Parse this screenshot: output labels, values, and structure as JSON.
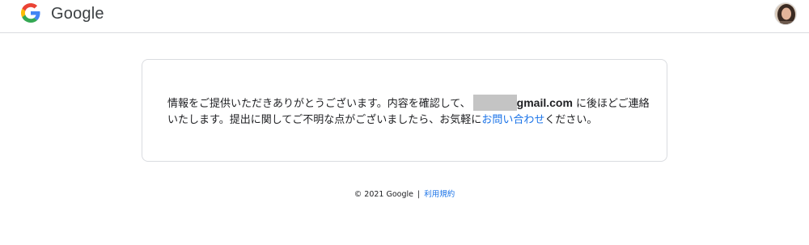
{
  "header": {
    "brand": "Google",
    "logo_icon": "google-g-logo-icon",
    "avatar_icon": "user-avatar-icon"
  },
  "message": {
    "part1": "情報をご提供いただきありがとうございます。内容を確認して、",
    "email_domain": "gmail.com",
    "part2": " に後ほどご連絡いたします。提出に関してご不明な点がございましたら、お気軽に",
    "contact_link": "お問い合わせ",
    "part3": "ください。"
  },
  "footer": {
    "copyright": "© 2021 Google",
    "separator": "|",
    "terms_link": "利用規約"
  },
  "colors": {
    "link": "#1a73e8",
    "border": "#dadce0",
    "text": "#202124"
  }
}
